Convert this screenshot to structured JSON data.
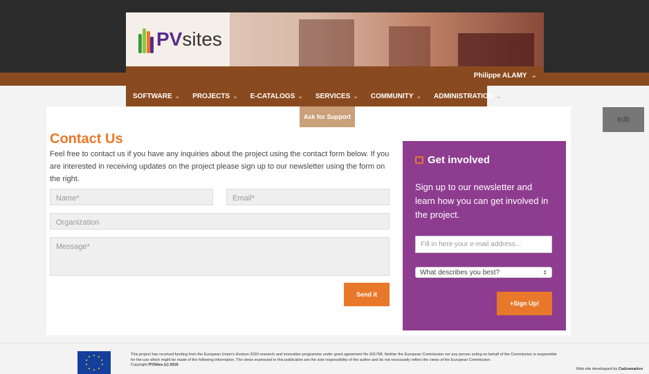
{
  "header": {
    "logo_prefix": "PV",
    "logo_suffix": "sites",
    "user_name": "Philippe ALAMY"
  },
  "nav": {
    "items": [
      {
        "label": "SOFTWARE"
      },
      {
        "label": "PROJECTS"
      },
      {
        "label": "E-CATALOGS"
      },
      {
        "label": "SERVICES"
      },
      {
        "label": "COMMUNITY"
      },
      {
        "label": "ADMINISTRATION"
      }
    ],
    "submenu_item": "Ask for Support"
  },
  "edit_label": "edit",
  "contact": {
    "title": "Contact Us",
    "intro": "Feel free to contact us if you have any inquiries about the project using the contact form below. If you are interested in receiving updates on the project please sign up to our newsletter using the form on the right.",
    "name_placeholder": "Name*",
    "email_placeholder": "Email*",
    "organization_placeholder": "Organization",
    "message_placeholder": "Message*",
    "send_label": "Send it"
  },
  "involved": {
    "title": "Get involved",
    "text": "Sign up to our newsletter and learn how you can get involved in the project.",
    "email_placeholder": "Fill in here your e-mail address...",
    "select_value": "What describes you best?",
    "signup_label": "+Sign Up!"
  },
  "footer": {
    "funding_line1": "This project has received funding from the European Union's Horizon 2020 research and innovation programme under grant agreement No 691768. Neither the European Commission nor any person acting on behalf of the Commission is responsible",
    "funding_line2": "for the use which might be made of the following information. The views expressed in this publication are the sole responsibility of the author and do not necessarily reflect the views of the European Commission.",
    "copyright_prefix": "Copyright ",
    "copyright_brand": "PVSites (c) 2016",
    "credit_prefix": "Web site developped by ",
    "credit_brand": "Cadcamation"
  },
  "colors": {
    "accent": "#e8782a",
    "brand_brown": "#8a4a1f",
    "purple": "#8e3c8f"
  }
}
